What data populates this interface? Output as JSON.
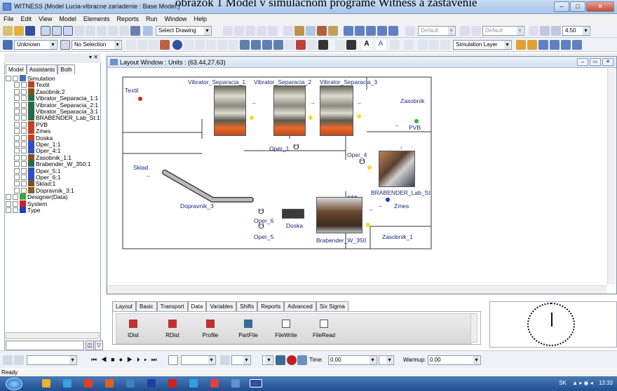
{
  "window": {
    "title": "WITNESS (Model Lucia-vibracne zariadenie : Base Model.)",
    "background_text": "obrázok 1 Model v simulačnom programe Witness a zastavenie"
  },
  "menu": [
    "File",
    "Edit",
    "View",
    "Model",
    "Elements",
    "Reports",
    "Run",
    "Window",
    "Help"
  ],
  "toolbar": {
    "select_drawing": "Select Drawing",
    "unknown": "Unknown",
    "no_selection": "No Selection",
    "default1": "Default",
    "default2": "Default",
    "size_value": "4.50",
    "sim_layer": "Simulation Layer"
  },
  "left_panel": {
    "tabs": [
      "Model",
      "Assistants",
      "Both"
    ],
    "tree": [
      {
        "label": "Simulation",
        "level": 0,
        "icon": "folder-icon",
        "color": "#4a6fb0"
      },
      {
        "label": "Textil",
        "level": 1,
        "icon": "part-icon",
        "color": "#c04020"
      },
      {
        "label": "Zasobnik:2",
        "level": 1,
        "icon": "buffer-icon",
        "color": "#805020"
      },
      {
        "label": "Vibrator_Separacia_1:1",
        "level": 1,
        "icon": "machine-icon",
        "color": "#2a6a4a"
      },
      {
        "label": "Vibrator_Separacia_2:1",
        "level": 1,
        "icon": "machine-icon",
        "color": "#2a6a4a"
      },
      {
        "label": "Vibrator_Separacia_3:1",
        "level": 1,
        "icon": "machine-icon",
        "color": "#2a6a4a"
      },
      {
        "label": "BRABENDER_Lab_St:1",
        "level": 1,
        "icon": "machine-icon",
        "color": "#2a6a4a"
      },
      {
        "label": "PVB",
        "level": 1,
        "icon": "part-icon",
        "color": "#c04020"
      },
      {
        "label": "Zmes",
        "level": 1,
        "icon": "part-icon",
        "color": "#c04020"
      },
      {
        "label": "Doska",
        "level": 1,
        "icon": "part-icon",
        "color": "#c04020"
      },
      {
        "label": "Oper_1:1",
        "level": 1,
        "icon": "labor-icon",
        "color": "#3050c0"
      },
      {
        "label": "Oper_4:1",
        "level": 1,
        "icon": "labor-icon",
        "color": "#3050c0"
      },
      {
        "label": "Zasobnik_1:1",
        "level": 1,
        "icon": "buffer-icon",
        "color": "#805020"
      },
      {
        "label": "Brabender_W_350:1",
        "level": 1,
        "icon": "machine-icon",
        "color": "#2a6a4a"
      },
      {
        "label": "Oper_5:1",
        "level": 1,
        "icon": "labor-icon",
        "color": "#3050c0"
      },
      {
        "label": "Oper_6:1",
        "level": 1,
        "icon": "labor-icon",
        "color": "#3050c0"
      },
      {
        "label": "Sklad:1",
        "level": 1,
        "icon": "buffer-icon",
        "color": "#805020"
      },
      {
        "label": "Dopravnik_3:1",
        "level": 1,
        "icon": "conveyor-icon",
        "color": "#806020"
      },
      {
        "label": "Designer(Data)",
        "level": 0,
        "icon": "designer-icon",
        "color": "#40a040"
      },
      {
        "label": "System",
        "level": 0,
        "icon": "system-icon",
        "color": "#d02020"
      },
      {
        "label": "Type",
        "level": 0,
        "icon": "type-icon",
        "color": "#2040c0"
      }
    ]
  },
  "layout_window": {
    "title": "Layout Window : Units : (63.44,27.63)",
    "labels": {
      "textil": "Textil",
      "vib1": "Vibrator_Separacia_1",
      "vib2": "Vibrator_Separacia_2",
      "vib3": "Vibrator_Separacia_3",
      "zasobnik": "Zasobnik",
      "pvb": "PVB",
      "oper1": "Oper_1",
      "oper4": "Oper_4",
      "sklad": "Sklad",
      "brabender_lab": "BRABENDER_Lab_St",
      "zmes": "Zmes",
      "dopravnik": "Dopravnik_3",
      "oper6": "Oper_6",
      "doska": "Doska",
      "oper5": "Oper_5",
      "brabender_w": "Brabender_W_350",
      "zasobnik1": "Zasobnik_1",
      "plus": "+++"
    }
  },
  "bottom_tabs": [
    "Layout",
    "Basic",
    "Transport",
    "Data",
    "Variables",
    "Shifts",
    "Reports",
    "Advanced",
    "Six Sigma"
  ],
  "bottom_items": [
    {
      "label": "IDist",
      "icon": "idist-icon"
    },
    {
      "label": "RDist",
      "icon": "rdist-icon"
    },
    {
      "label": "Profile",
      "icon": "profile-icon"
    },
    {
      "label": "PartFile",
      "icon": "partfile-icon"
    },
    {
      "label": "FileWrite",
      "icon": "filewrite-icon"
    },
    {
      "label": "FileRead",
      "icon": "fileread-icon"
    }
  ],
  "run_bar": {
    "time_label": "Time:",
    "time_value": "0.00",
    "warmup_label": "Warmup:",
    "warmup_value": "0.00"
  },
  "status": "Ready",
  "taskbar": {
    "lang": "SK",
    "time": "13:33"
  },
  "colors": {
    "accent": "#1a2a7a",
    "red_dot": "#e02020",
    "yellow_dot": "#f0e020",
    "green_dot": "#20c020",
    "blue_dot": "#2030c0"
  }
}
